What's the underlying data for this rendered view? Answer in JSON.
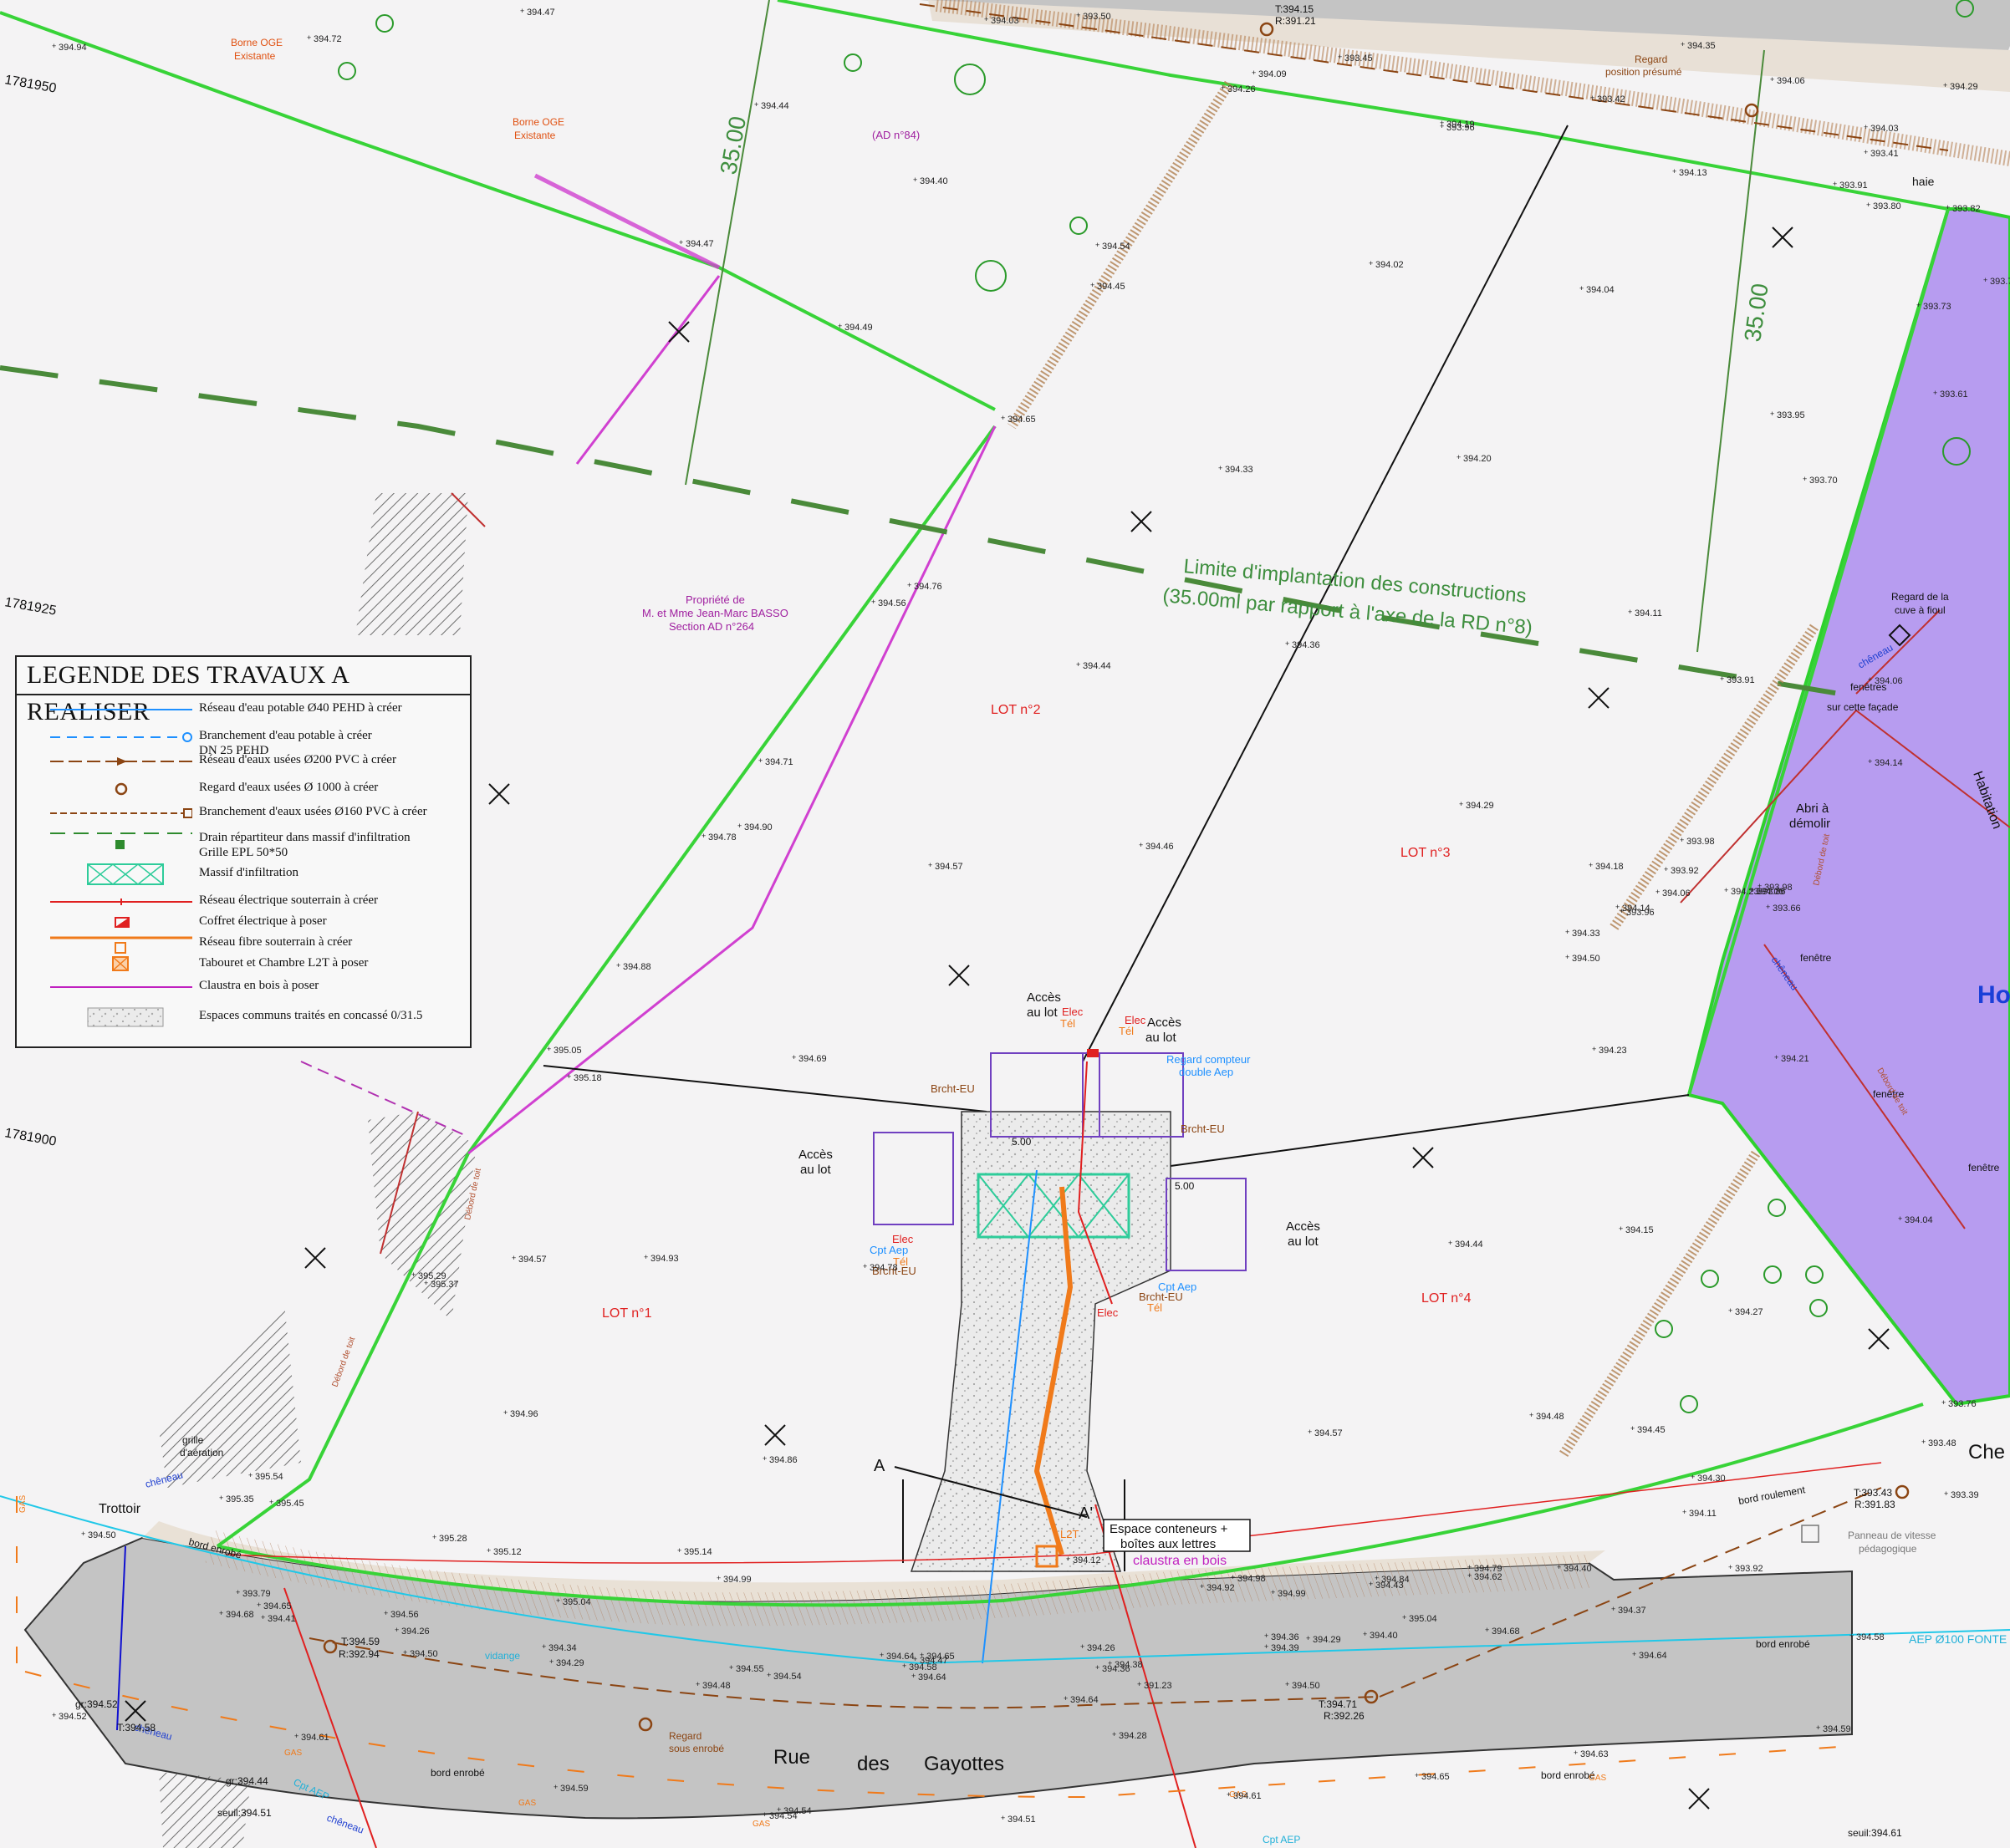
{
  "legend": {
    "title": "LEGENDE DES TRAVAUX A REALISER",
    "items": [
      {
        "label": "Réseau d'eau potable Ø40 PEHD à créer",
        "line2": "",
        "color": "#1e90ff",
        "symbol": "solid-line"
      },
      {
        "label": "Branchement d'eau potable à créer",
        "line2": "DN 25 PEHD",
        "color": "#1e90ff",
        "symbol": "dashed-line-circle"
      },
      {
        "label": "Réseau d'eaux usées Ø200 PVC à créer",
        "line2": "",
        "color": "#8b4513",
        "symbol": "arrow-line"
      },
      {
        "label": "Regard d'eaux usées Ø 1000 à créer",
        "line2": "",
        "color": "#8b4513",
        "symbol": "circle"
      },
      {
        "label": "Branchement d'eaux usées Ø160 PVC à créer",
        "line2": "",
        "color": "#8b4513",
        "symbol": "dashed-line-square"
      },
      {
        "label": "Drain répartiteur dans massif d'infiltration",
        "line2": "Grille EPL 50*50",
        "color": "#2e8b2e",
        "symbol": "dashed-green-grid"
      },
      {
        "label": "Massif d'infiltration",
        "line2": "",
        "color": "#2ecc9a",
        "symbol": "cross-box"
      },
      {
        "label": "Réseau électrique souterrain à créer",
        "line2": "",
        "color": "#e02020",
        "symbol": "red-line"
      },
      {
        "label": "Coffret électrique à poser",
        "line2": "",
        "color": "#e02020",
        "symbol": "red-box"
      },
      {
        "label": "Réseau fibre souterrain à créer",
        "line2": "",
        "color": "#f07a1a",
        "symbol": "orange-line-box"
      },
      {
        "label": "Tabouret et Chambre L2T à poser",
        "line2": "",
        "color": "#f07a1a",
        "symbol": "orange-box"
      },
      {
        "label": "Claustra en bois à poser",
        "line2": "",
        "color": "#c020c0",
        "symbol": "magenta-line"
      },
      {
        "label": "Espaces communs traités en concassé 0/31.5",
        "line2": "",
        "color": "#cccccc",
        "symbol": "gravel"
      }
    ]
  },
  "lots": {
    "lot1": "LOT n°1",
    "lot2": "LOT n°2",
    "lot3": "LOT n°3",
    "lot4": "LOT n°4"
  },
  "parcels": {
    "ad84": "(AD n°84)",
    "basso_line1": "Propriété de",
    "basso_line2": "M. et Mme Jean-Marc BASSO",
    "basso_line3": "Section AD n°264"
  },
  "limit": {
    "line1": "Limite d'implantation des constructions",
    "line2": "(35.00ml par rapport à l'axe de la RD n°8)",
    "dim_left": "35.00",
    "dim_right": "35.00"
  },
  "road": {
    "name_part1": "Rue",
    "name_part2": "des",
    "name_part3": "Gayottes",
    "trottoir": "Trottoir"
  },
  "access": {
    "acces1": "Accès",
    "acces2": "au lot",
    "conteneurs1": "Espace conteneurs +",
    "conteneurs2": "boîtes aux lettres",
    "claustra": "claustra en bois",
    "regard_compteur1": "Regard compteur",
    "regard_compteur2": "double Aep",
    "brcht_eu": "Brcht-EU",
    "elec": "Elec",
    "tel": "Tél",
    "cpt_aep": "Cpt Aep",
    "l2t": "L2T",
    "dim_5": "5.00",
    "section_a": "A",
    "section_a2": "A'"
  },
  "annotations": {
    "borne1": "Borne OGE",
    "borne2": "Existante",
    "regard_presume1": "Regard",
    "regard_presume2": "position présumé",
    "regard_sous1": "Regard",
    "regard_sous2": "sous enrobé",
    "grille1": "grille",
    "grille2": "d'aération",
    "cuve1": "Regard de la",
    "cuve2": "cuve à fioul",
    "abri1": "Abri à",
    "abri2": "démolir",
    "fenetres1": "fenêtres",
    "fenetres2": "sur cette façade",
    "fenetre": "fenêtre",
    "haie": "haie",
    "cheneau": "chêneau",
    "panneau1": "Panneau de vitesse",
    "panneau2": "pédagogique",
    "bord_enrobe": "bord enrobé",
    "bord_roulement": "bord roulement",
    "vidange": "vidange",
    "aep100": "AEP Ø100 FONTE",
    "cpt_aep": "Cpt AEP",
    "gas": "GAS",
    "ho": "Ho",
    "habitation": "Habitation",
    "che": "Che",
    "debord": "Débord de toit",
    "t1": "T:394.15",
    "r1": "R:391.21",
    "t2": "T:394.59",
    "r2": "R:392.94",
    "t3": "T:394.71",
    "r3": "R:392.26",
    "t4": "T:393.43",
    "r4": "R:391.83",
    "t5": "T:394.58",
    "gr1": "gr:394.52",
    "gr2": "gr:394.44",
    "seuil1": "seuil:394.51",
    "seuil2": "seuil:394.61",
    "coord1": "1781950",
    "coord2": "1781925",
    "coord3": "1781900"
  },
  "spot_elevations": [
    {
      "v": "394.47"
    },
    {
      "v": "394.44"
    },
    {
      "v": "394.40"
    },
    {
      "v": "394.49"
    },
    {
      "v": "394.02"
    },
    {
      "v": "394.04"
    },
    {
      "v": "394.13"
    },
    {
      "v": "394.19"
    },
    {
      "v": "394.33"
    },
    {
      "v": "394.20"
    },
    {
      "v": "393.95"
    },
    {
      "v": "393.70"
    },
    {
      "v": "394.76"
    },
    {
      "v": "394.44"
    },
    {
      "v": "394.36"
    },
    {
      "v": "394.11"
    },
    {
      "v": "393.91"
    },
    {
      "v": "394.90"
    },
    {
      "v": "394.57"
    },
    {
      "v": "394.46"
    },
    {
      "v": "394.29"
    },
    {
      "v": "394.18"
    },
    {
      "v": "394.69"
    },
    {
      "v": "394.23"
    },
    {
      "v": "394.21"
    },
    {
      "v": "394.93"
    },
    {
      "v": "394.44"
    },
    {
      "v": "394.15"
    },
    {
      "v": "394.27"
    },
    {
      "v": "394.04"
    },
    {
      "v": "394.96"
    },
    {
      "v": "394.86"
    },
    {
      "v": "394.57"
    },
    {
      "v": "394.48"
    },
    {
      "v": "394.45"
    },
    {
      "v": "395.18"
    },
    {
      "v": "395.37"
    },
    {
      "v": "395.54"
    },
    {
      "v": "395.28"
    },
    {
      "v": "394.79"
    },
    {
      "v": "394.30"
    },
    {
      "v": "394.11"
    },
    {
      "v": "393.48"
    },
    {
      "v": "393.39"
    },
    {
      "v": "394.99"
    },
    {
      "v": "395.14"
    },
    {
      "v": "395.12"
    },
    {
      "v": "395.04"
    },
    {
      "v": "394.64"
    },
    {
      "v": "394.68"
    },
    {
      "v": "394.54"
    },
    {
      "v": "394.50"
    },
    {
      "v": "394.59"
    },
    {
      "v": "394.63"
    },
    {
      "v": "394.65"
    },
    {
      "v": "394.61"
    },
    {
      "v": "394.54"
    },
    {
      "v": "394.51"
    },
    {
      "v": "394.35"
    },
    {
      "v": "394.29"
    },
    {
      "v": "393.78"
    },
    {
      "v": "393.73"
    },
    {
      "v": "393.61"
    },
    {
      "v": "394.06"
    },
    {
      "v": "394.14"
    },
    {
      "v": "394.06"
    },
    {
      "v": "395.35"
    },
    {
      "v": "395.45"
    },
    {
      "v": "394.50"
    },
    {
      "v": "394.68"
    },
    {
      "v": "394.52"
    },
    {
      "v": "394.61"
    },
    {
      "v": "394.54"
    },
    {
      "v": "394.72"
    },
    {
      "v": "394.94"
    },
    {
      "v": "394.03"
    },
    {
      "v": "393.50"
    },
    {
      "v": "393.45"
    },
    {
      "v": "394.09"
    },
    {
      "v": "393.96"
    },
    {
      "v": "393.42"
    },
    {
      "v": "394.06"
    },
    {
      "v": "394.03"
    },
    {
      "v": "393.41"
    },
    {
      "v": "393.82"
    },
    {
      "v": "393.91"
    },
    {
      "v": "393.80"
    },
    {
      "v": "394.26"
    },
    {
      "v": "394.54"
    },
    {
      "v": "394.45"
    },
    {
      "v": "394.65"
    },
    {
      "v": "394.47"
    },
    {
      "v": "394.56"
    },
    {
      "v": "394.71"
    },
    {
      "v": "394.78"
    },
    {
      "v": "394.88"
    },
    {
      "v": "395.05"
    },
    {
      "v": "395.29"
    },
    {
      "v": "394.57"
    },
    {
      "v": "394.78"
    },
    {
      "v": "394.65"
    },
    {
      "v": "394.58"
    },
    {
      "v": "394.99"
    },
    {
      "v": "394.98"
    },
    {
      "v": "394.92"
    },
    {
      "v": "394.84"
    },
    {
      "v": "395.04"
    },
    {
      "v": "394.62"
    },
    {
      "v": "394.40"
    },
    {
      "v": "394.43"
    },
    {
      "v": "394.37"
    },
    {
      "v": "393.92"
    },
    {
      "v": "394.40"
    },
    {
      "v": "394.29"
    },
    {
      "v": "394.39"
    },
    {
      "v": "394.26"
    },
    {
      "v": "394.36"
    },
    {
      "v": "394.28"
    },
    {
      "v": "394.34"
    },
    {
      "v": "394.29"
    },
    {
      "v": "394.36"
    },
    {
      "v": "394.56"
    },
    {
      "v": "394.26"
    },
    {
      "v": "394.47"
    },
    {
      "v": "394.64"
    },
    {
      "v": "394.64"
    },
    {
      "v": "394.38"
    },
    {
      "v": "391.23"
    },
    {
      "v": "394.50"
    },
    {
      "v": "394.55"
    },
    {
      "v": "394.48"
    },
    {
      "v": "394.41"
    },
    {
      "v": "394.65"
    },
    {
      "v": "393.79"
    },
    {
      "v": "394.12"
    },
    {
      "v": "393.98"
    },
    {
      "v": "393.92"
    },
    {
      "v": "393.96"
    },
    {
      "v": "393.66"
    },
    {
      "v": "393.98"
    },
    {
      "v": "393.86"
    },
    {
      "v": "394.06"
    },
    {
      "v": "394.23"
    },
    {
      "v": "394.14"
    },
    {
      "v": "394.33"
    },
    {
      "v": "394.50"
    },
    {
      "v": "393.76"
    },
    {
      "v": "394.58"
    },
    {
      "v": "394.64"
    },
    {
      "v": "394.59"
    }
  ]
}
